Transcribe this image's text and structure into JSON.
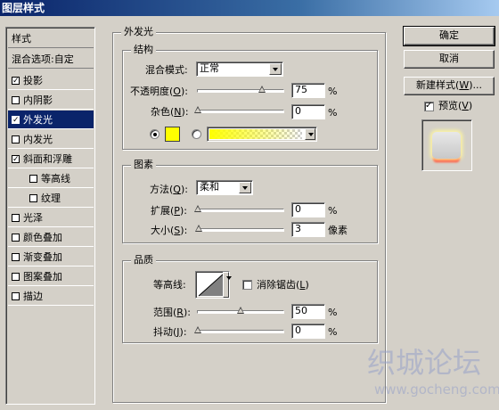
{
  "window": {
    "title": "图层样式"
  },
  "sidebar": {
    "header": "样式",
    "blend": "混合选项:自定",
    "items": [
      {
        "label": "投影",
        "checked": true
      },
      {
        "label": "内阴影",
        "checked": false
      },
      {
        "label": "外发光",
        "checked": true,
        "selected": true
      },
      {
        "label": "内发光",
        "checked": false
      },
      {
        "label": "斜面和浮雕",
        "checked": true
      },
      {
        "label": "等高线",
        "checked": false,
        "indent": true
      },
      {
        "label": "纹理",
        "checked": false,
        "indent": true
      },
      {
        "label": "光泽",
        "checked": false
      },
      {
        "label": "颜色叠加",
        "checked": false
      },
      {
        "label": "渐变叠加",
        "checked": false
      },
      {
        "label": "图案叠加",
        "checked": false
      },
      {
        "label": "描边",
        "checked": false
      }
    ]
  },
  "outer_glow": {
    "title": "外发光",
    "structure": {
      "title": "结构",
      "blend_mode_label": "混合模式:",
      "blend_mode_value": "正常",
      "opacity_label": "不透明度(",
      "opacity_key": "O",
      "opacity_tail": "):",
      "opacity_value": "75",
      "opacity_fraction": 0.75,
      "noise_label": "杂色(",
      "noise_key": "N",
      "noise_tail": "):",
      "noise_value": "0",
      "noise_fraction": 0.0,
      "percent": "%",
      "color_swatch": "#ffff00",
      "gradient_from": "#ffff00"
    },
    "elements": {
      "title": "图素",
      "method_label": "方法(",
      "method_key": "Q",
      "method_tail": "):",
      "method_value": "柔和",
      "spread_label": "扩展(",
      "spread_key": "P",
      "spread_tail": "):",
      "spread_value": "0",
      "spread_fraction": 0.0,
      "size_label": "大小(",
      "size_key": "S",
      "size_tail": "):",
      "size_value": "3",
      "size_fraction": 0.012,
      "size_unit": "像素",
      "percent": "%"
    },
    "quality": {
      "title": "品质",
      "contour_label": "等高线:",
      "antialias_label": "消除锯齿(",
      "antialias_key": "L",
      "antialias_tail": ")",
      "antialias_checked": false,
      "range_label": "范围(",
      "range_key": "R",
      "range_tail": "):",
      "range_value": "50",
      "range_fraction": 0.5,
      "jitter_label": "抖动(",
      "jitter_key": "J",
      "jitter_tail": "):",
      "jitter_value": "0",
      "jitter_fraction": 0.0,
      "percent": "%"
    }
  },
  "buttons": {
    "ok": "确定",
    "cancel": "取消",
    "new_style_prefix": "新建样式(",
    "new_style_key": "W",
    "new_style_suffix": ")...",
    "preview_label_prefix": "预览(",
    "preview_key": "V",
    "preview_label_suffix": ")",
    "preview_checked": true
  },
  "watermark": {
    "line1": "织城论坛",
    "line2": "www.gocheng.com"
  }
}
